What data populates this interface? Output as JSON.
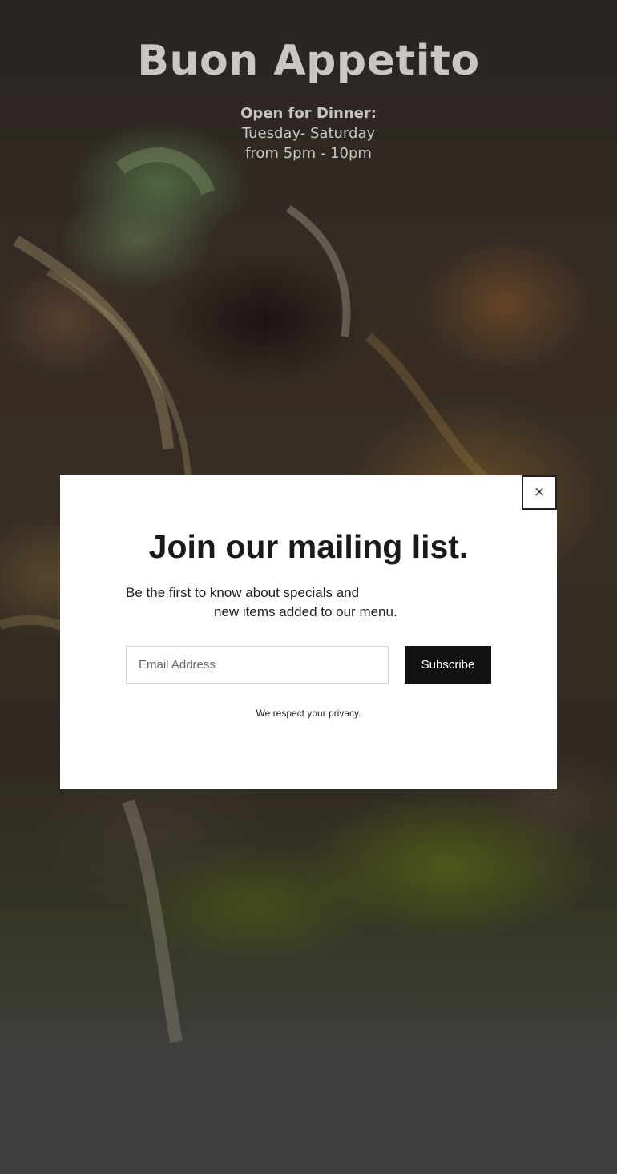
{
  "hero": {
    "title": "Buon Appetito",
    "hours_heading": "Open for Dinner:",
    "hours_days": "Tuesday- Saturday",
    "hours_time": "from 5pm - 10pm",
    "background": "food photo (pasta with herbs)"
  },
  "modal": {
    "close_label": "×",
    "title": "Join our mailing list.",
    "description_line1": "Be the first to know about specials and",
    "description_line2": "new items added to our menu.",
    "email_placeholder": "Email Address",
    "email_value": "",
    "subscribe_label": "Subscribe",
    "privacy_note": "We respect your privacy."
  },
  "colors": {
    "modal_background": "#ffffff",
    "button_background": "#111111",
    "button_text": "#ffffff",
    "hero_text": "#c9c6c3"
  },
  "icons": {
    "close": "close-icon"
  }
}
